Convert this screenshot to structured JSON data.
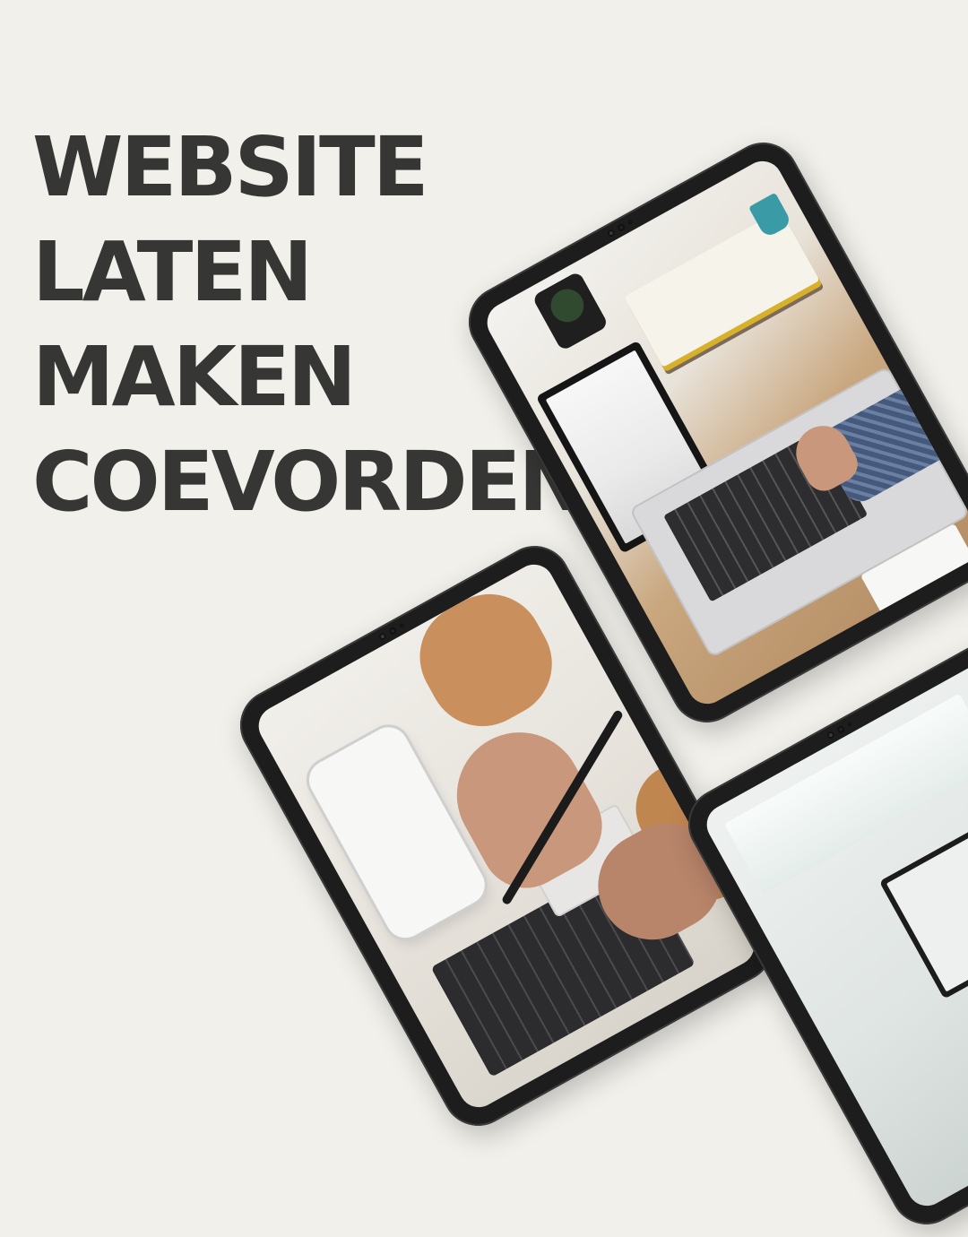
{
  "headline": {
    "lines": [
      "WEBSITE",
      "LATEN",
      "MAKEN",
      "COEVORDEN"
    ]
  },
  "images": {
    "tablet_a": "desk-laptop-photo",
    "tablet_b": "hands-typing-photo",
    "tablet_c": "office-laptop-photo"
  },
  "colors": {
    "background": "#f1f0eb",
    "headline": "#363634",
    "tablet_frame": "#1d1d1d"
  }
}
